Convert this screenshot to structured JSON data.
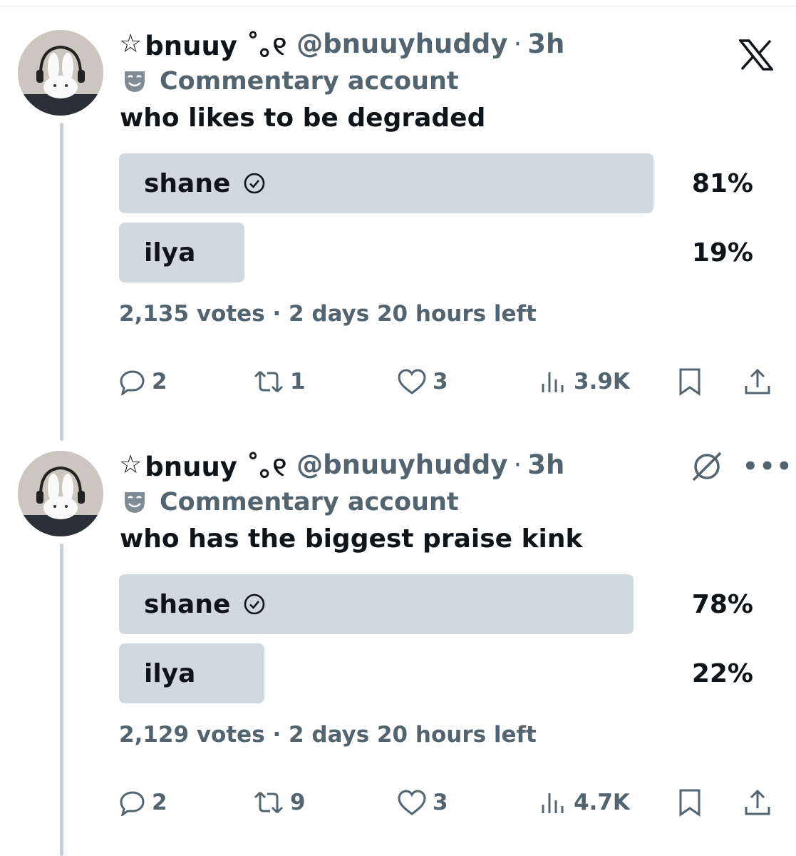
{
  "tweets": [
    {
      "author": {
        "star": "☆",
        "display_name": "bnuuy ˚｡୧",
        "handle": "@bnuuyhuddy",
        "sep": "·",
        "time": "3h",
        "label": "Commentary account"
      },
      "text": "who likes to be degraded",
      "poll": {
        "options": [
          {
            "label": "shane",
            "percent_text": "81%",
            "percent": 81,
            "verified_check": true
          },
          {
            "label": "ilya",
            "percent_text": "19%",
            "percent": 19,
            "verified_check": false
          }
        ],
        "meta": "2,135 votes · 2 days 20 hours left"
      },
      "actions": {
        "replies": "2",
        "reposts": "1",
        "likes": "3",
        "views": "3.9K"
      },
      "top_right_icon": "x-logo-icon"
    },
    {
      "author": {
        "star": "☆",
        "display_name": "bnuuy ˚｡୧",
        "handle": "@bnuuyhuddy",
        "sep": "·",
        "time": "3h",
        "label": "Commentary account"
      },
      "text": "who has the biggest praise kink",
      "poll": {
        "options": [
          {
            "label": "shane",
            "percent_text": "78%",
            "percent": 78,
            "verified_check": true
          },
          {
            "label": "ilya",
            "percent_text": "22%",
            "percent": 22,
            "verified_check": false
          }
        ],
        "meta": "2,129 votes · 2 days 20 hours left"
      },
      "actions": {
        "replies": "2",
        "reposts": "9",
        "likes": "3",
        "views": "4.7K"
      },
      "top_right_icon": "grok-icon"
    }
  ],
  "colors": {
    "text": "#0f1419",
    "muted": "#536471",
    "poll_fill": "#cfd9de",
    "thread_line": "#c9cfd4"
  }
}
